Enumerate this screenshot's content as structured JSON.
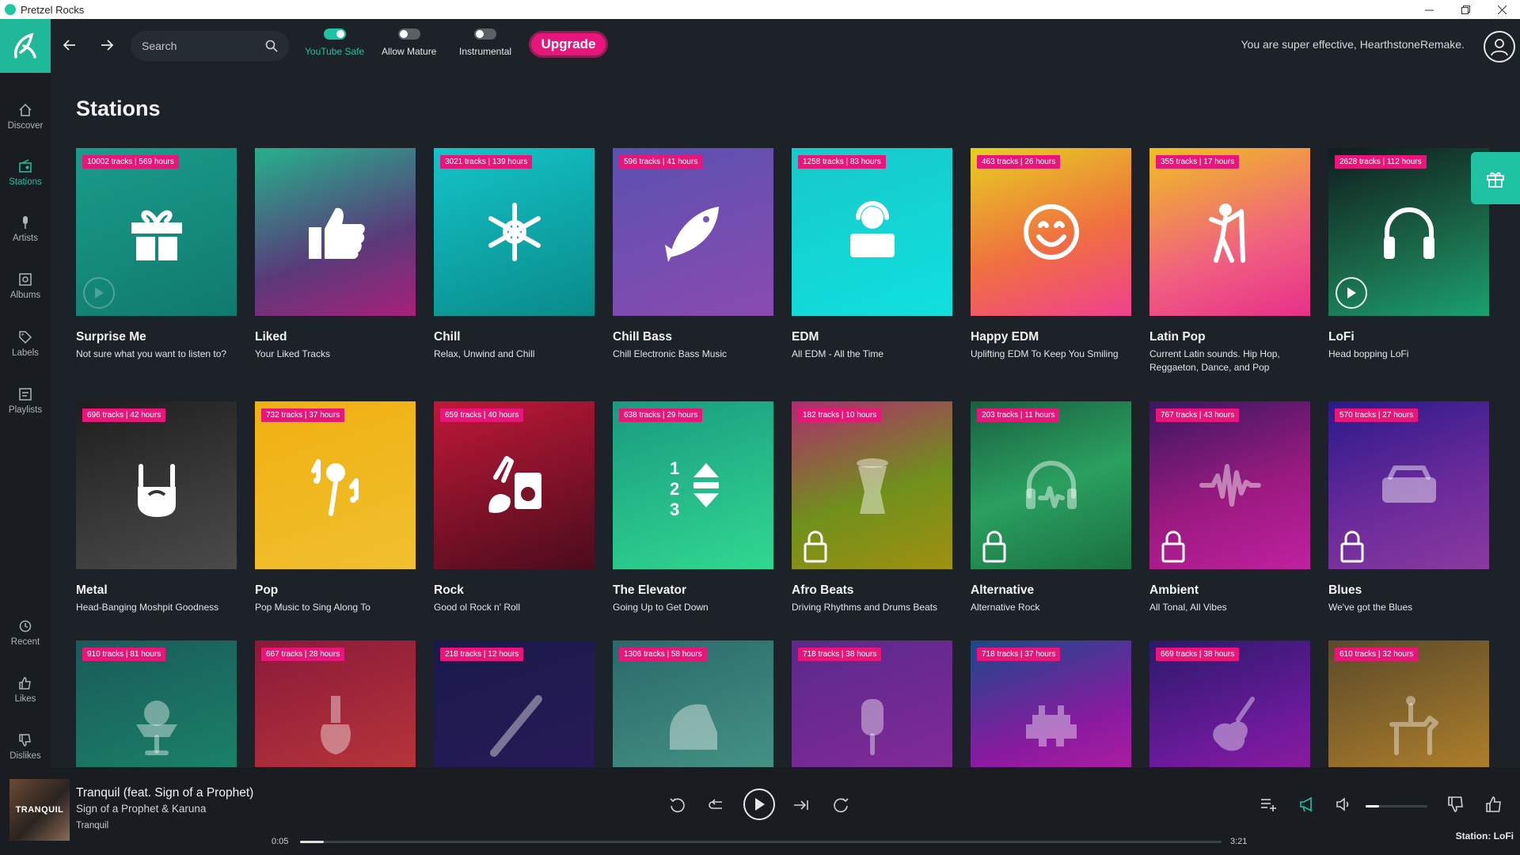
{
  "window": {
    "title": "Pretzel Rocks"
  },
  "nav": {
    "items": [
      {
        "label": "Discover"
      },
      {
        "label": "Stations"
      },
      {
        "label": "Artists"
      },
      {
        "label": "Albums"
      },
      {
        "label": "Labels"
      },
      {
        "label": "Playlists"
      },
      {
        "label": "Recent"
      },
      {
        "label": "Likes"
      },
      {
        "label": "Dislikes"
      }
    ]
  },
  "topbar": {
    "search_placeholder": "Search",
    "toggles": [
      {
        "label": "YouTube Safe",
        "on": true
      },
      {
        "label": "Allow Mature",
        "on": false
      },
      {
        "label": "Instrumental",
        "on": false
      }
    ],
    "upgrade_label": "Upgrade",
    "greeting": "You are super effective, HearthstoneRemake."
  },
  "page": {
    "title": "Stations"
  },
  "stations": [
    {
      "name": "Surprise Me",
      "desc": "Not sure what you want to listen to?",
      "badge": "10002 tracks | 569 hours",
      "icon": "gift-icon",
      "locked": false
    },
    {
      "name": "Liked",
      "desc": "Your Liked Tracks",
      "badge": "",
      "icon": "thumbs-up-icon",
      "locked": false
    },
    {
      "name": "Chill",
      "desc": "Relax, Unwind and Chill",
      "badge": "3021 tracks | 139 hours",
      "icon": "snowflake-icon",
      "locked": false
    },
    {
      "name": "Chill Bass",
      "desc": "Chill Electronic Bass Music",
      "badge": "596 tracks | 41 hours",
      "icon": "fish-icon",
      "locked": false
    },
    {
      "name": "EDM",
      "desc": "All EDM - All the Time",
      "badge": "1258 tracks | 83 hours",
      "icon": "dj-icon",
      "locked": false
    },
    {
      "name": "Happy EDM",
      "desc": "Uplifting EDM To Keep You Smiling",
      "badge": "463 tracks | 26 hours",
      "icon": "smile-icon",
      "locked": false
    },
    {
      "name": "Latin Pop",
      "desc": "Current Latin sounds. Hip Hop, Reggaeton, Dance, and Pop",
      "badge": "355 tracks | 17 hours",
      "icon": "singer-icon",
      "locked": false
    },
    {
      "name": "LoFi",
      "desc": "Head bopping LoFi",
      "badge": "2628 tracks | 112 hours",
      "icon": "headphones-icon",
      "locked": false
    },
    {
      "name": "Metal",
      "desc": "Head-Banging Moshpit Goodness",
      "badge": "696 tracks | 42 hours",
      "icon": "rock-hand-icon",
      "locked": false
    },
    {
      "name": "Pop",
      "desc": "Pop Music to Sing Along To",
      "badge": "732 tracks | 37 hours",
      "icon": "microphone-icon",
      "locked": false
    },
    {
      "name": "Rock",
      "desc": "Good ol Rock n' Roll",
      "badge": "659 tracks | 40 hours",
      "icon": "guitar-amp-icon",
      "locked": false
    },
    {
      "name": "The Elevator",
      "desc": "Going Up to Get Down",
      "badge": "638 tracks | 29 hours",
      "icon": "elevator-icon",
      "locked": false
    },
    {
      "name": "Afro Beats",
      "desc": "Driving Rhythms and Drums Beats",
      "badge": "182 tracks | 10 hours",
      "icon": "djembe-icon",
      "locked": true
    },
    {
      "name": "Alternative",
      "desc": "Alternative Rock",
      "badge": "203 tracks | 11 hours",
      "icon": "headphones-wave-icon",
      "locked": true
    },
    {
      "name": "Ambient",
      "desc": "All Tonal, All Vibes",
      "badge": "767 tracks | 43 hours",
      "icon": "waveform-icon",
      "locked": true
    },
    {
      "name": "Blues",
      "desc": "We've got the Blues",
      "badge": "570 tracks | 27 hours",
      "icon": "radio-icon",
      "locked": true
    },
    {
      "name": "",
      "desc": "",
      "badge": "910 tracks | 81 hours",
      "icon": "ice-cream-icon",
      "locked": false
    },
    {
      "name": "",
      "desc": "",
      "badge": "667 tracks | 28 hours",
      "icon": "acoustic-guitar-icon",
      "locked": false
    },
    {
      "name": "",
      "desc": "",
      "badge": "218 tracks | 12 hours",
      "icon": "clarinet-icon",
      "locked": false
    },
    {
      "name": "",
      "desc": "",
      "badge": "1306 tracks | 58 hours",
      "icon": "piano-icon",
      "locked": false
    },
    {
      "name": "",
      "desc": "",
      "badge": "718 tracks | 38 hours",
      "icon": "popsicle-icon",
      "locked": false
    },
    {
      "name": "",
      "desc": "",
      "badge": "718 tracks | 37 hours",
      "icon": "space-invader-icon",
      "locked": false
    },
    {
      "name": "",
      "desc": "",
      "badge": "669 tracks | 38 hours",
      "icon": "cello-icon",
      "locked": false
    },
    {
      "name": "",
      "desc": "",
      "badge": "610 tracks | 32 hours",
      "icon": "horse-rider-icon",
      "locked": false
    }
  ],
  "player": {
    "album_art_text": "TRANQUIL",
    "track_title": "Tranquil (feat. Sign of a Prophet)",
    "artist": "Sign of a Prophet & Karuna",
    "album": "Tranquil",
    "current_time": "0:05",
    "total_time": "3:21",
    "progress": 0.026,
    "volume": 0.22,
    "station": "Station: LoFi"
  },
  "colors": {
    "accent": "#1fc3a3",
    "brand": "#e8167a",
    "background": "#1d2228"
  }
}
